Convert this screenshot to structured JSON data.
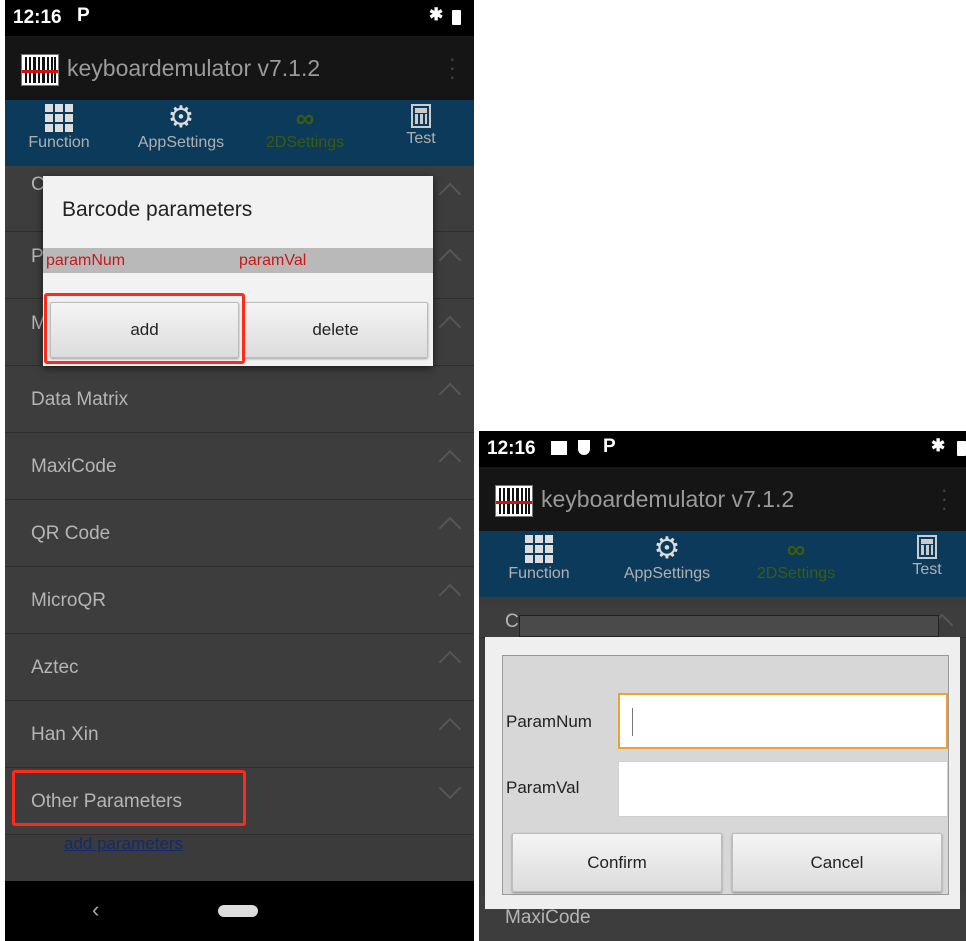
{
  "left_screen": {
    "status": {
      "time": "12:16"
    },
    "app": {
      "title": "keyboardemulator v7.1.2"
    },
    "tabs": [
      {
        "label": "Function",
        "icon": "grid-icon"
      },
      {
        "label": "AppSettings",
        "icon": "gear-icon"
      },
      {
        "label": "2DSettings",
        "icon": "link-icon",
        "active": true
      },
      {
        "label": "Test",
        "icon": "calculator-icon"
      }
    ],
    "hidden_rows": [
      "C",
      "P",
      "M"
    ],
    "rows": [
      "Data Matrix",
      "MaxiCode",
      "QR Code",
      "MicroQR",
      "Aztec",
      "Han Xin",
      "Other Parameters"
    ],
    "add_parameters_link": "add parameters",
    "dialog": {
      "title": "Barcode parameters",
      "col1": "paramNum",
      "col2": "paramVal",
      "add_label": "add",
      "delete_label": "delete"
    }
  },
  "right_screen": {
    "status": {
      "time": "12:16"
    },
    "app": {
      "title": "keyboardemulator v7.1.2"
    },
    "tabs": [
      {
        "label": "Function"
      },
      {
        "label": "AppSettings"
      },
      {
        "label": "2DSettings",
        "active": true
      },
      {
        "label": "Test"
      }
    ],
    "partial_row": "C",
    "bottom_row": "MaxiCode",
    "dialog": {
      "param_num_label": "ParamNum",
      "param_val_label": "ParamVal",
      "param_num_value": "",
      "param_val_value": "",
      "confirm_label": "Confirm",
      "cancel_label": "Cancel"
    }
  },
  "colors": {
    "highlight": "#ff2a1a",
    "focus": "#f0a030",
    "tabbar": "#0b3a5a"
  }
}
